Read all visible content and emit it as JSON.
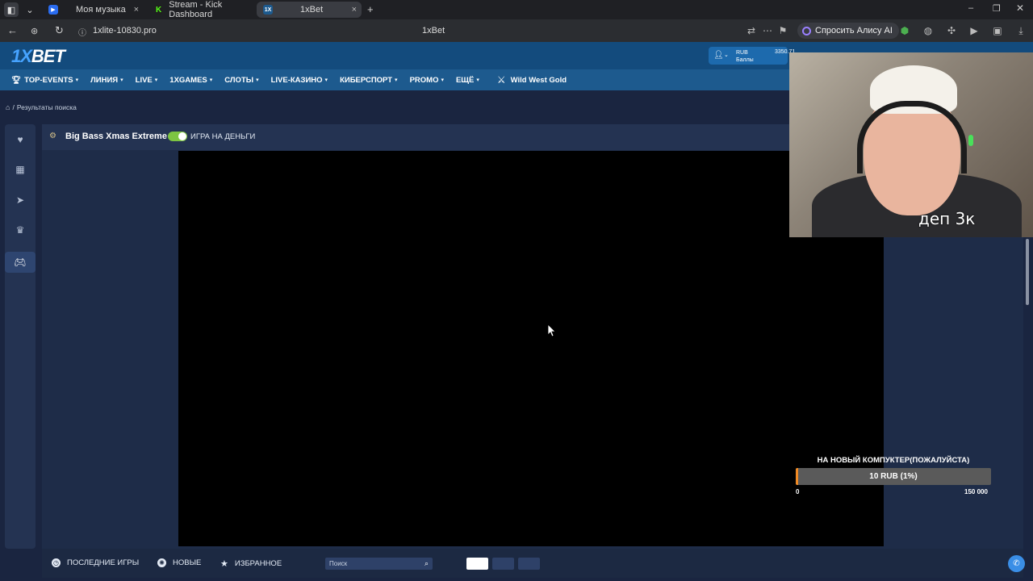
{
  "browser": {
    "tabs": [
      {
        "label": "Моя музыка"
      },
      {
        "label": "Stream - Kick Dashboard"
      },
      {
        "label": "1xBet"
      }
    ],
    "url": "1xlite-10830.pro",
    "page_title": "1xBet",
    "ask_alice": "Спросить Алису AI"
  },
  "site": {
    "logo_prefix": "1X",
    "logo_suffix": "BET",
    "account": {
      "currency": "RUB",
      "points_label": "Баллы",
      "balance": "3350.71"
    },
    "nav": [
      {
        "label": "TOP-EVENTS"
      },
      {
        "label": "ЛИНИЯ"
      },
      {
        "label": "LIVE"
      },
      {
        "label": "1XGAMES"
      },
      {
        "label": "СЛОТЫ"
      },
      {
        "label": "LIVE-КАЗИНО"
      },
      {
        "label": "КИБЕРСПОРТ"
      },
      {
        "label": "PROMO"
      },
      {
        "label": "ЕЩЁ"
      }
    ],
    "promo_game": "Wild West Gold"
  },
  "breadcrumb": {
    "current": "Результаты поиска"
  },
  "game": {
    "title": "Big Bass Xmas Extreme",
    "money_toggle_label": "ИГРА НА ДЕНЬГИ",
    "money_toggle_on": true
  },
  "bottom": {
    "recent_label": "ПОСЛЕДНИЕ ИГРЫ",
    "new_label": "НОВЫЕ",
    "fav_label": "ИЗБРАННОЕ",
    "search_placeholder": "Поиск"
  },
  "overlay": {
    "webcam_caption": "деп 3к",
    "goal_title": "НА НОВЫЙ КОМПУКТЕР(ПОЖАЛУЙСТА)",
    "goal_progress_text": "10 RUB (1%)",
    "goal_progress_fraction": 0.01,
    "goal_min": "0",
    "goal_max": "150 000"
  },
  "colors": {
    "header_bg": "#134b7d",
    "nav_bg": "#1d5a8e",
    "page_bg": "#1a2540",
    "toggle_on": "#7dc442",
    "goal_fill": "#f08a24"
  }
}
